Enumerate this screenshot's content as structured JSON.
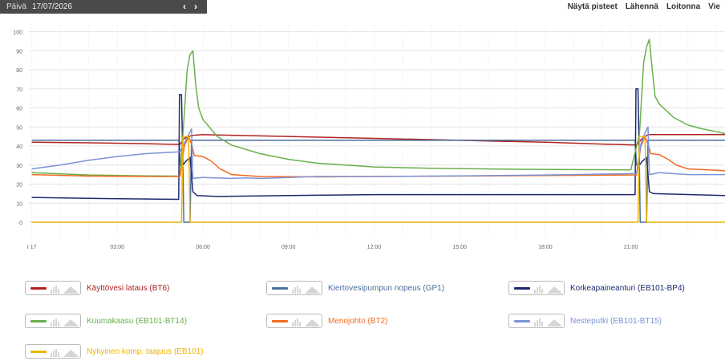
{
  "header": {
    "period_label": "Päivä",
    "date": "17/07/2026",
    "prev_icon": "chevron-left-icon",
    "next_icon": "chevron-right-icon",
    "prev_glyph": "‹",
    "next_glyph": "›",
    "actions": [
      "Näytä pisteet",
      "Lähennä",
      "Loitonna",
      "Vie"
    ]
  },
  "chart_data": {
    "type": "line",
    "title": "",
    "xlabel": "",
    "ylabel": "",
    "xlim": [
      -0.1,
      24.3
    ],
    "ylim": [
      -8,
      104
    ],
    "yticks": [
      0,
      10,
      20,
      30,
      40,
      50,
      60,
      70,
      80,
      90,
      100
    ],
    "xticks": [
      {
        "x": 0,
        "label": "r 17"
      },
      {
        "x": 3,
        "label": "03:00"
      },
      {
        "x": 6,
        "label": "06:00"
      },
      {
        "x": 9,
        "label": "09:00"
      },
      {
        "x": 12,
        "label": "12:00"
      },
      {
        "x": 15,
        "label": "15:00"
      },
      {
        "x": 18,
        "label": "18:00"
      },
      {
        "x": 21,
        "label": "21:00"
      }
    ],
    "grid": true,
    "series": [
      {
        "name": "Käyttövesi lataus (BT6)",
        "color": "#b22222",
        "points": [
          [
            0,
            42
          ],
          [
            2,
            41.7
          ],
          [
            4,
            41.2
          ],
          [
            5.2,
            40.8
          ],
          [
            5.35,
            44
          ],
          [
            5.6,
            45.5
          ],
          [
            6,
            46
          ],
          [
            9,
            45
          ],
          [
            12,
            44
          ],
          [
            15,
            43
          ],
          [
            18,
            42
          ],
          [
            20,
            41
          ],
          [
            21.2,
            40.5
          ],
          [
            21.4,
            44
          ],
          [
            21.6,
            46
          ],
          [
            24.3,
            46
          ]
        ]
      },
      {
        "name": "Kiertovesipumpun nopeus (GP1)",
        "color": "#4a6f9c",
        "points": [
          [
            0,
            43
          ],
          [
            5.17,
            43
          ],
          [
            5.2,
            30
          ],
          [
            5.3,
            29
          ],
          [
            5.33,
            0
          ],
          [
            5.55,
            0
          ],
          [
            5.6,
            43
          ],
          [
            21.15,
            43
          ],
          [
            21.2,
            30
          ],
          [
            21.3,
            29
          ],
          [
            21.33,
            0
          ],
          [
            21.55,
            0
          ],
          [
            21.6,
            43
          ],
          [
            24.3,
            43
          ]
        ]
      },
      {
        "name": "Korkeapaineanturi (EB101-BP4)",
        "color": "#1f2a6e",
        "points": [
          [
            0,
            13
          ],
          [
            2,
            12.5
          ],
          [
            5.15,
            12
          ],
          [
            5.18,
            67
          ],
          [
            5.25,
            67
          ],
          [
            5.3,
            30
          ],
          [
            5.4,
            32
          ],
          [
            5.55,
            34
          ],
          [
            5.65,
            16
          ],
          [
            5.8,
            14
          ],
          [
            6.5,
            13.5
          ],
          [
            9,
            14
          ],
          [
            12,
            14.5
          ],
          [
            15,
            14.5
          ],
          [
            18,
            14.5
          ],
          [
            21.15,
            14.5
          ],
          [
            21.18,
            70
          ],
          [
            21.25,
            70
          ],
          [
            21.3,
            30
          ],
          [
            21.4,
            32
          ],
          [
            21.55,
            34
          ],
          [
            21.65,
            16
          ],
          [
            21.8,
            15
          ],
          [
            24.3,
            14
          ]
        ]
      },
      {
        "name": "Kuumakaasu (EB101-BT14)",
        "color": "#6ab04c",
        "points": [
          [
            0,
            26
          ],
          [
            2,
            24.8
          ],
          [
            4,
            24.3
          ],
          [
            5.2,
            24.2
          ],
          [
            5.3,
            46
          ],
          [
            5.45,
            80
          ],
          [
            5.55,
            88
          ],
          [
            5.65,
            90
          ],
          [
            5.75,
            72
          ],
          [
            5.85,
            60
          ],
          [
            6,
            54
          ],
          [
            6.5,
            45
          ],
          [
            7,
            40.5
          ],
          [
            8,
            36
          ],
          [
            9,
            33
          ],
          [
            10,
            31
          ],
          [
            11,
            30
          ],
          [
            12,
            29
          ],
          [
            14,
            28.3
          ],
          [
            17,
            27.8
          ],
          [
            21,
            27.5
          ],
          [
            21.3,
            46
          ],
          [
            21.45,
            84
          ],
          [
            21.55,
            92
          ],
          [
            21.65,
            96
          ],
          [
            21.75,
            80
          ],
          [
            21.85,
            66
          ],
          [
            22,
            62
          ],
          [
            22.5,
            55
          ],
          [
            23,
            51
          ],
          [
            23.5,
            49
          ],
          [
            24,
            47.5
          ],
          [
            24.3,
            46.5
          ]
        ]
      },
      {
        "name": "Menojohto (BT2)",
        "color": "#f26a21",
        "points": [
          [
            0,
            25
          ],
          [
            2,
            24.2
          ],
          [
            4,
            24
          ],
          [
            5.2,
            24
          ],
          [
            5.35,
            40
          ],
          [
            5.5,
            45
          ],
          [
            5.6,
            41
          ],
          [
            5.7,
            35
          ],
          [
            6,
            34.5
          ],
          [
            6.3,
            32
          ],
          [
            6.6,
            28
          ],
          [
            7,
            25
          ],
          [
            8,
            24
          ],
          [
            10,
            23.8
          ],
          [
            12,
            24
          ],
          [
            15,
            24.2
          ],
          [
            18,
            24.5
          ],
          [
            21.2,
            24.8
          ],
          [
            21.35,
            40
          ],
          [
            21.5,
            45
          ],
          [
            21.6,
            41
          ],
          [
            21.7,
            36
          ],
          [
            22,
            35.5
          ],
          [
            22.3,
            33
          ],
          [
            22.6,
            30
          ],
          [
            23,
            28
          ],
          [
            24.3,
            27
          ]
        ]
      },
      {
        "name": "Nesteputki (EB101-BT15)",
        "color": "#7b93d6",
        "points": [
          [
            0,
            28
          ],
          [
            1,
            30
          ],
          [
            2,
            32.5
          ],
          [
            3,
            34.5
          ],
          [
            4,
            36
          ],
          [
            5,
            36.8
          ],
          [
            5.2,
            37
          ],
          [
            5.3,
            40
          ],
          [
            5.5,
            46
          ],
          [
            5.6,
            49
          ],
          [
            5.65,
            23
          ],
          [
            6,
            23.5
          ],
          [
            7,
            23
          ],
          [
            7.5,
            23.3
          ],
          [
            8,
            23
          ],
          [
            8.5,
            23.2
          ],
          [
            9,
            23.5
          ],
          [
            10,
            24
          ],
          [
            12,
            24
          ],
          [
            15,
            24.3
          ],
          [
            18,
            24.8
          ],
          [
            21.2,
            25.5
          ],
          [
            21.35,
            41
          ],
          [
            21.5,
            47
          ],
          [
            21.6,
            50
          ],
          [
            21.65,
            25
          ],
          [
            22,
            26
          ],
          [
            23,
            25
          ],
          [
            24.3,
            25
          ]
        ]
      },
      {
        "name": "Nykyinen komp. taajuus (EB101)",
        "color": "#f0b400",
        "points": [
          [
            0,
            0
          ],
          [
            5.25,
            0
          ],
          [
            5.3,
            45
          ],
          [
            5.5,
            45
          ],
          [
            5.55,
            0
          ],
          [
            21.25,
            0
          ],
          [
            21.3,
            45
          ],
          [
            21.5,
            45
          ],
          [
            21.55,
            0
          ],
          [
            24.3,
            0
          ]
        ]
      }
    ]
  },
  "legend_layout": [
    {
      "col": 0,
      "row": 0
    },
    {
      "col": 1,
      "row": 0
    },
    {
      "col": 2,
      "row": 0
    },
    {
      "col": 0,
      "row": 1
    },
    {
      "col": 1,
      "row": 1
    },
    {
      "col": 2,
      "row": 1
    },
    {
      "col": 0,
      "row": 2
    }
  ]
}
